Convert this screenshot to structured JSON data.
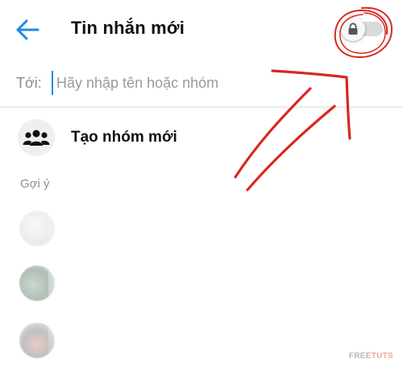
{
  "header": {
    "title": "Tin nhắn mới",
    "back_icon": "arrow-left-icon",
    "secret_toggle": {
      "state": "off",
      "icon": "lock-icon"
    }
  },
  "recipient": {
    "label": "Tới:",
    "placeholder": "Hãy nhập tên hoặc nhóm",
    "value": ""
  },
  "new_group": {
    "label": "Tạo nhóm mới",
    "icon": "people-group-icon"
  },
  "suggestions": {
    "section_label": "Gợi ý",
    "items": [
      {
        "name": ""
      },
      {
        "name": ""
      },
      {
        "name": ""
      }
    ]
  },
  "watermark": {
    "text_main": "FREE",
    "text_accent": "TUTS"
  },
  "colors": {
    "accent_blue": "#1e88e5",
    "annotation_red": "#d8281e",
    "text_gray": "#8e8e8e"
  }
}
